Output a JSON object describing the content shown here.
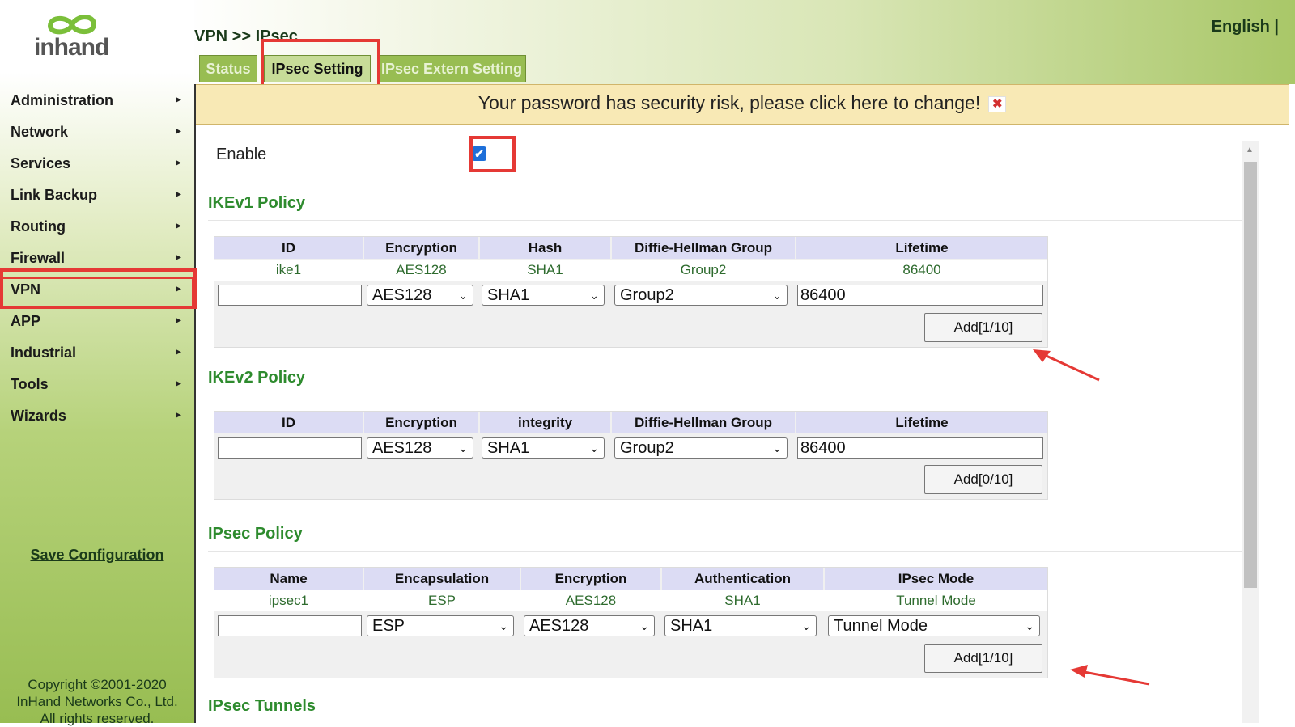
{
  "header": {
    "logo_text": "inhand",
    "breadcrumb": "VPN >> IPsec",
    "language": "English |"
  },
  "tabs": [
    {
      "label": "Status"
    },
    {
      "label": "IPsec Setting"
    },
    {
      "label": "IPsec Extern Setting"
    }
  ],
  "sidebar": {
    "items": [
      {
        "label": "Administration"
      },
      {
        "label": "Network"
      },
      {
        "label": "Services"
      },
      {
        "label": "Link Backup"
      },
      {
        "label": "Routing"
      },
      {
        "label": "Firewall"
      },
      {
        "label": "VPN"
      },
      {
        "label": "APP"
      },
      {
        "label": "Industrial"
      },
      {
        "label": "Tools"
      },
      {
        "label": "Wizards"
      }
    ],
    "arrow": "▸",
    "save_label": "Save Configuration",
    "copyright_1": "Copyright ©2001-2020",
    "copyright_2": "InHand Networks Co., Ltd.",
    "copyright_3": "All rights reserved."
  },
  "banner": {
    "text": "Your password has security risk, please click here to change!",
    "close": "✖"
  },
  "enable": {
    "label": "Enable",
    "checked_mark": "✔"
  },
  "ikev1": {
    "title": "IKEv1 Policy",
    "headers": [
      "ID",
      "Encryption",
      "Hash",
      "Diffie-Hellman Group",
      "Lifetime"
    ],
    "row": [
      "ike1",
      "AES128",
      "SHA1",
      "Group2",
      "86400"
    ],
    "form": {
      "id": "",
      "encryption": "AES128",
      "hash": "SHA1",
      "dh": "Group2",
      "lifetime": "86400"
    },
    "add_label": "Add[1/10]"
  },
  "ikev2": {
    "title": "IKEv2 Policy",
    "headers": [
      "ID",
      "Encryption",
      "integrity",
      "Diffie-Hellman Group",
      "Lifetime"
    ],
    "form": {
      "id": "",
      "encryption": "AES128",
      "integrity": "SHA1",
      "dh": "Group2",
      "lifetime": "86400"
    },
    "add_label": "Add[0/10]"
  },
  "ipsec": {
    "title": "IPsec Policy",
    "headers": [
      "Name",
      "Encapsulation",
      "Encryption",
      "Authentication",
      "IPsec Mode"
    ],
    "row": [
      "ipsec1",
      "ESP",
      "AES128",
      "SHA1",
      "Tunnel Mode"
    ],
    "form": {
      "name": "",
      "encapsulation": "ESP",
      "encryption": "AES128",
      "authentication": "SHA1",
      "mode": "Tunnel Mode"
    },
    "add_label": "Add[1/10]"
  },
  "tunnels": {
    "title": "IPsec Tunnels"
  },
  "colors": {
    "accent_green": "#98bd52",
    "title_green": "#2e8b2e",
    "highlight_red": "#e53935"
  }
}
